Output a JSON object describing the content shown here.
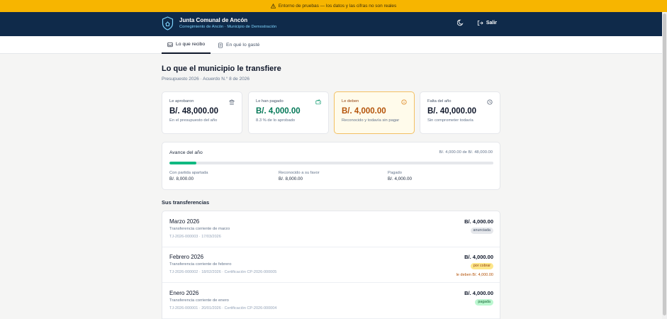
{
  "banner": {
    "text": "Entorno de pruebas — los datos y las cifras no son reales",
    "icon": "warning-icon",
    "color": "#f7b500"
  },
  "header": {
    "title": "Junta Comunal de Ancón",
    "subtitle": "Corregimiento de Ancón · Municipio de Demostración",
    "theme_icon": "moon-icon",
    "exit_label": "Salir",
    "bg_color": "#0f2a4a"
  },
  "tabs": [
    {
      "label": "Lo que recibo",
      "icon": "inbox-icon",
      "active": true
    },
    {
      "label": "En qué lo gasté",
      "icon": "receipt-icon",
      "active": false
    }
  ],
  "page": {
    "title": "Lo que el municipio le transfiere",
    "subtitle": "Presupuesto 2026 · Acuerdo N.° 8 de 2026"
  },
  "cards": [
    {
      "label": "Le aprobaron",
      "value": "B/. 48,000.00",
      "hint": "En el presupuesto del año",
      "icon": "bank-icon",
      "color": "#0f172a"
    },
    {
      "label": "Le han pagado",
      "value": "B/. 4,000.00",
      "hint": "8.3 % de lo aprobado",
      "icon": "wallet-icon",
      "color": "#047857"
    },
    {
      "label": "Le deben",
      "value": "B/. 4,000.00",
      "hint": "Reconocido y todavía sin pagar",
      "icon": "info-icon",
      "color": "#b45309"
    },
    {
      "label": "Falta del año",
      "value": "B/. 40,000.00",
      "hint": "Sin comprometer todavía",
      "icon": "clock-icon",
      "color": "#0f172a"
    }
  ],
  "progress": {
    "title": "Avance del año",
    "total": "B/. 4,000.00 de B/. 48,000.00",
    "fraction": 0.083,
    "stats": [
      {
        "label": "Con partida apartada",
        "value": "B/. 8,000.00"
      },
      {
        "label": "Reconocido a su favor",
        "value": "B/. 8,000.00"
      },
      {
        "label": "Pagado",
        "value": "B/. 4,000.00"
      }
    ]
  },
  "transfers": {
    "title": "Sus transferencias",
    "items": [
      {
        "month": "Marzo 2026",
        "desc": "Transferencia corriente de marzo",
        "ref": "TJ-2026-000003 · 17/03/2026",
        "amount": "B/. 4,000.00",
        "badge": "anunciada",
        "badge_bg": "#e5e7eb",
        "badge_fg": "#475569",
        "owed": ""
      },
      {
        "month": "Febrero 2026",
        "desc": "Transferencia corriente de febrero",
        "ref": "TJ-2026-000002 · 18/02/2026 · Certificación CP-2026-000005",
        "amount": "B/. 4,000.00",
        "badge": "por cobrar",
        "badge_bg": "#fde68a",
        "badge_fg": "#92400e",
        "owed": "le deben B/. 4,000.00"
      },
      {
        "month": "Enero 2026",
        "desc": "Transferencia corriente de enero",
        "ref": "TJ-2026-000001 · 20/01/2026 · Certificación CP-2026-000004",
        "amount": "B/. 4,000.00",
        "badge": "pagada",
        "badge_bg": "#bbf7d0",
        "badge_fg": "#166534",
        "owed": ""
      }
    ]
  }
}
